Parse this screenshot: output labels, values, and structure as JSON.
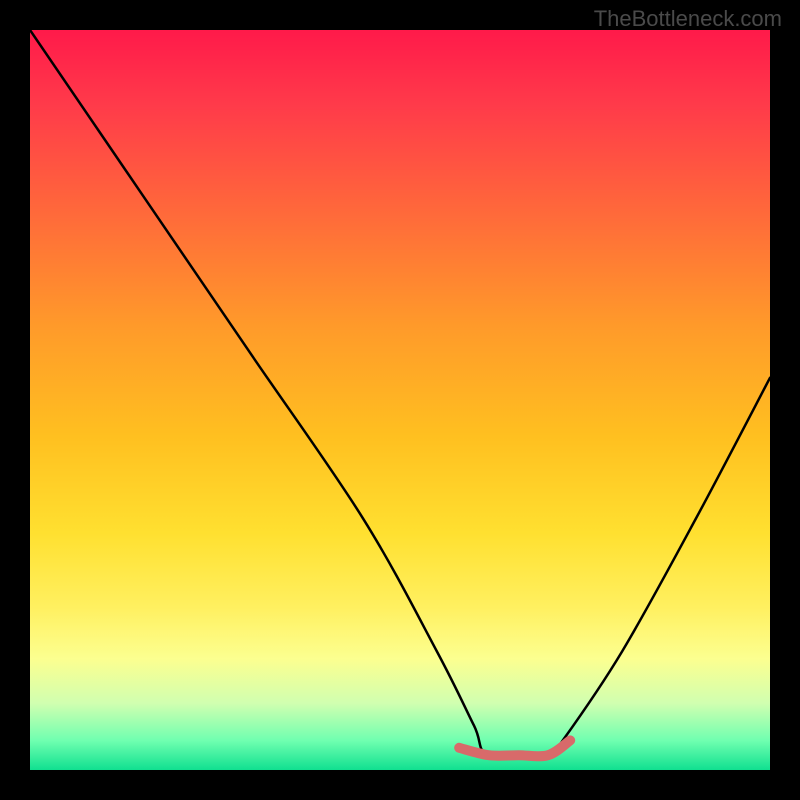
{
  "watermark": "TheBottleneck.com",
  "chart_data": {
    "type": "line",
    "title": "",
    "xlabel": "",
    "ylabel": "",
    "xlim": [
      0,
      100
    ],
    "ylim": [
      0,
      100
    ],
    "gradient_note": "Background vertical gradient from red (top, high bottleneck) through orange, yellow to green (bottom, low bottleneck)",
    "series": [
      {
        "name": "bottleneck-curve",
        "x": [
          0,
          15,
          30,
          45,
          55,
          60,
          62,
          70,
          72,
          80,
          90,
          100
        ],
        "values": [
          100,
          78,
          56,
          34,
          16,
          6,
          2,
          2,
          4,
          16,
          34,
          53
        ],
        "color": "#000000"
      },
      {
        "name": "optimal-segment",
        "x": [
          58,
          62,
          66,
          70,
          73
        ],
        "values": [
          3,
          2,
          2,
          2,
          4
        ],
        "color": "#d86a6a",
        "stroke_width_px": 10
      }
    ]
  }
}
